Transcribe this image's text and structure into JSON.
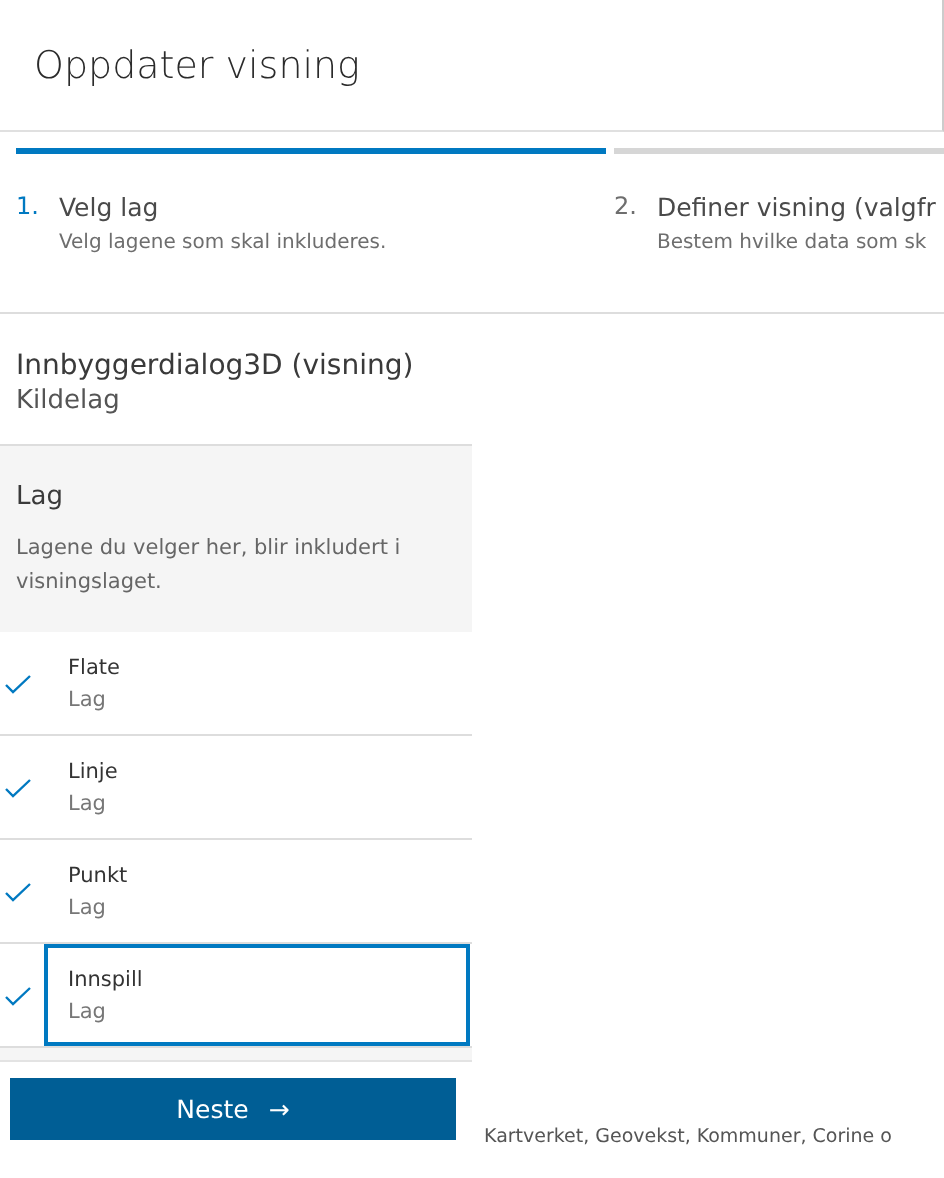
{
  "dialog": {
    "title": "Oppdater visning"
  },
  "steps": [
    {
      "number": "1.",
      "title": "Velg lag",
      "description": "Velg lagene som skal inkluderes.",
      "selected": true
    },
    {
      "number": "2.",
      "title": "Definer visning (valgfr",
      "description": "Bestem hvilke data som sk",
      "selected": false
    }
  ],
  "source": {
    "name": "Innbyggerdialog3D (visning)",
    "caption": "Kildelag"
  },
  "layers_section": {
    "heading": "Lag",
    "description": "Lagene du velger her, blir inkludert i visningslaget."
  },
  "layers": [
    {
      "name": "Flate",
      "type": "Lag",
      "checked": true,
      "focused": false
    },
    {
      "name": "Linje",
      "type": "Lag",
      "checked": true,
      "focused": false
    },
    {
      "name": "Punkt",
      "type": "Lag",
      "checked": true,
      "focused": false
    },
    {
      "name": "Innspill",
      "type": "Lag",
      "checked": true,
      "focused": true
    }
  ],
  "next_button": {
    "label": "Neste",
    "arrow": "→"
  },
  "attribution": "Kartverket, Geovekst, Kommuner, Corine o"
}
